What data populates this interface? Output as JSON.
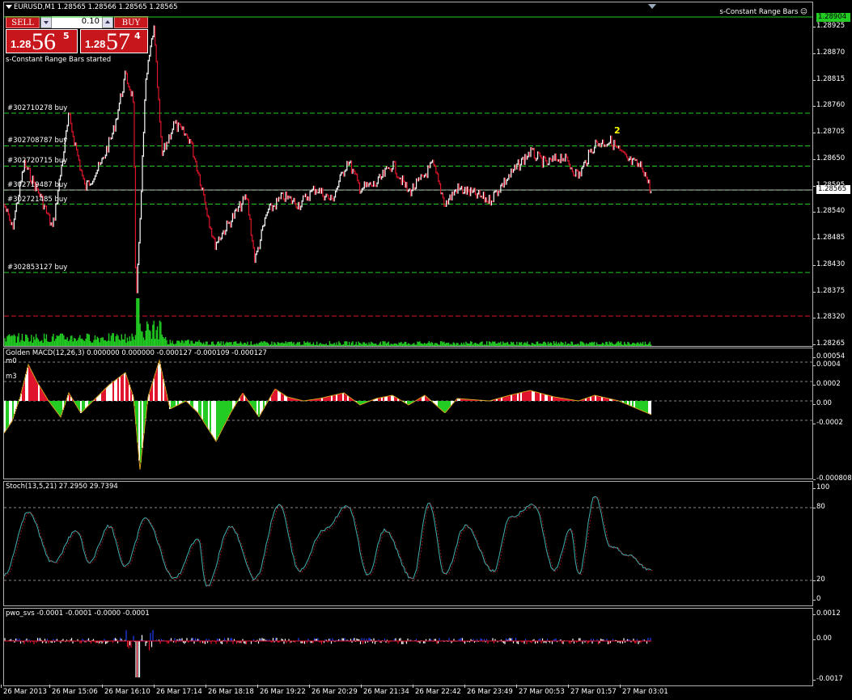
{
  "chart": {
    "symbol_title": "EURUSD,M1  1.28565 1.28566 1.28565 1.28565",
    "indicator_name": "s-Constant Range Bars",
    "status_text": "s-Constant Range Bars started",
    "current_price": "1.28565",
    "top_price": "1.28904",
    "marker_label": "2"
  },
  "one_click": {
    "sell_label": "SELL",
    "buy_label": "BUY",
    "lot_value": "0.10",
    "sell_prefix": "1.28",
    "sell_big": "56",
    "sell_sup": "5",
    "buy_prefix": "1.28",
    "buy_big": "57",
    "buy_sup": "4"
  },
  "main_scale": [
    "1.28925",
    "1.28870",
    "1.28815",
    "1.28760",
    "1.28705",
    "1.28650",
    "1.28595",
    "1.28540",
    "1.28485",
    "1.28430",
    "1.28375",
    "1.28320",
    "1.28265"
  ],
  "trades": [
    {
      "label": "#302710278 buy",
      "price": 1.28747
    },
    {
      "label": "#302708787 buy",
      "price": 1.28679
    },
    {
      "label": "#302720715 buy",
      "price": 1.28637
    },
    {
      "label": "#302719487 buy",
      "price": 1.28587
    },
    {
      "label": "#302721485 buy",
      "price": 1.28558
    },
    {
      "label": "#302853127 buy",
      "price": 1.28416
    }
  ],
  "macd": {
    "label": "Golden MACD(12,26,3) 0.000000 0.000000 -0.000127 -0.000109 -0.000127",
    "sub_labels": [
      "m0",
      "m3"
    ],
    "scale": [
      "0.00054",
      "0.0004",
      "0.0002",
      "0.00",
      "-0.0002",
      "-0.000808"
    ]
  },
  "stoch": {
    "label": "Stoch(13,5,21) 27.2950 29.7394",
    "scale": [
      "100",
      "80",
      "20",
      "0"
    ]
  },
  "pwo": {
    "label": "pwo_svs -0.0001 -0.0001 -0.0000 -0.0001",
    "scale": [
      "0.0012",
      "0.00",
      "-0.0017"
    ]
  },
  "time_axis": [
    "26 Mar 2013",
    "26 Mar 15:06",
    "26 Mar 16:10",
    "26 Mar 17:14",
    "26 Mar 18:18",
    "26 Mar 19:22",
    "26 Mar 20:29",
    "26 Mar 21:34",
    "26 Mar 22:42",
    "26 Mar 23:49",
    "27 Mar 00:53",
    "27 Mar 01:57",
    "27 Mar 03:01"
  ],
  "colors": {
    "bull": "#ffffff",
    "bear": "#e0142c",
    "volume": "#22cc22",
    "trade_line": "#22cc22",
    "stop_line": "#e0142c",
    "macd_up": "#e0142c",
    "macd_down": "#22cc22",
    "stoch": "#40b0b0"
  }
}
